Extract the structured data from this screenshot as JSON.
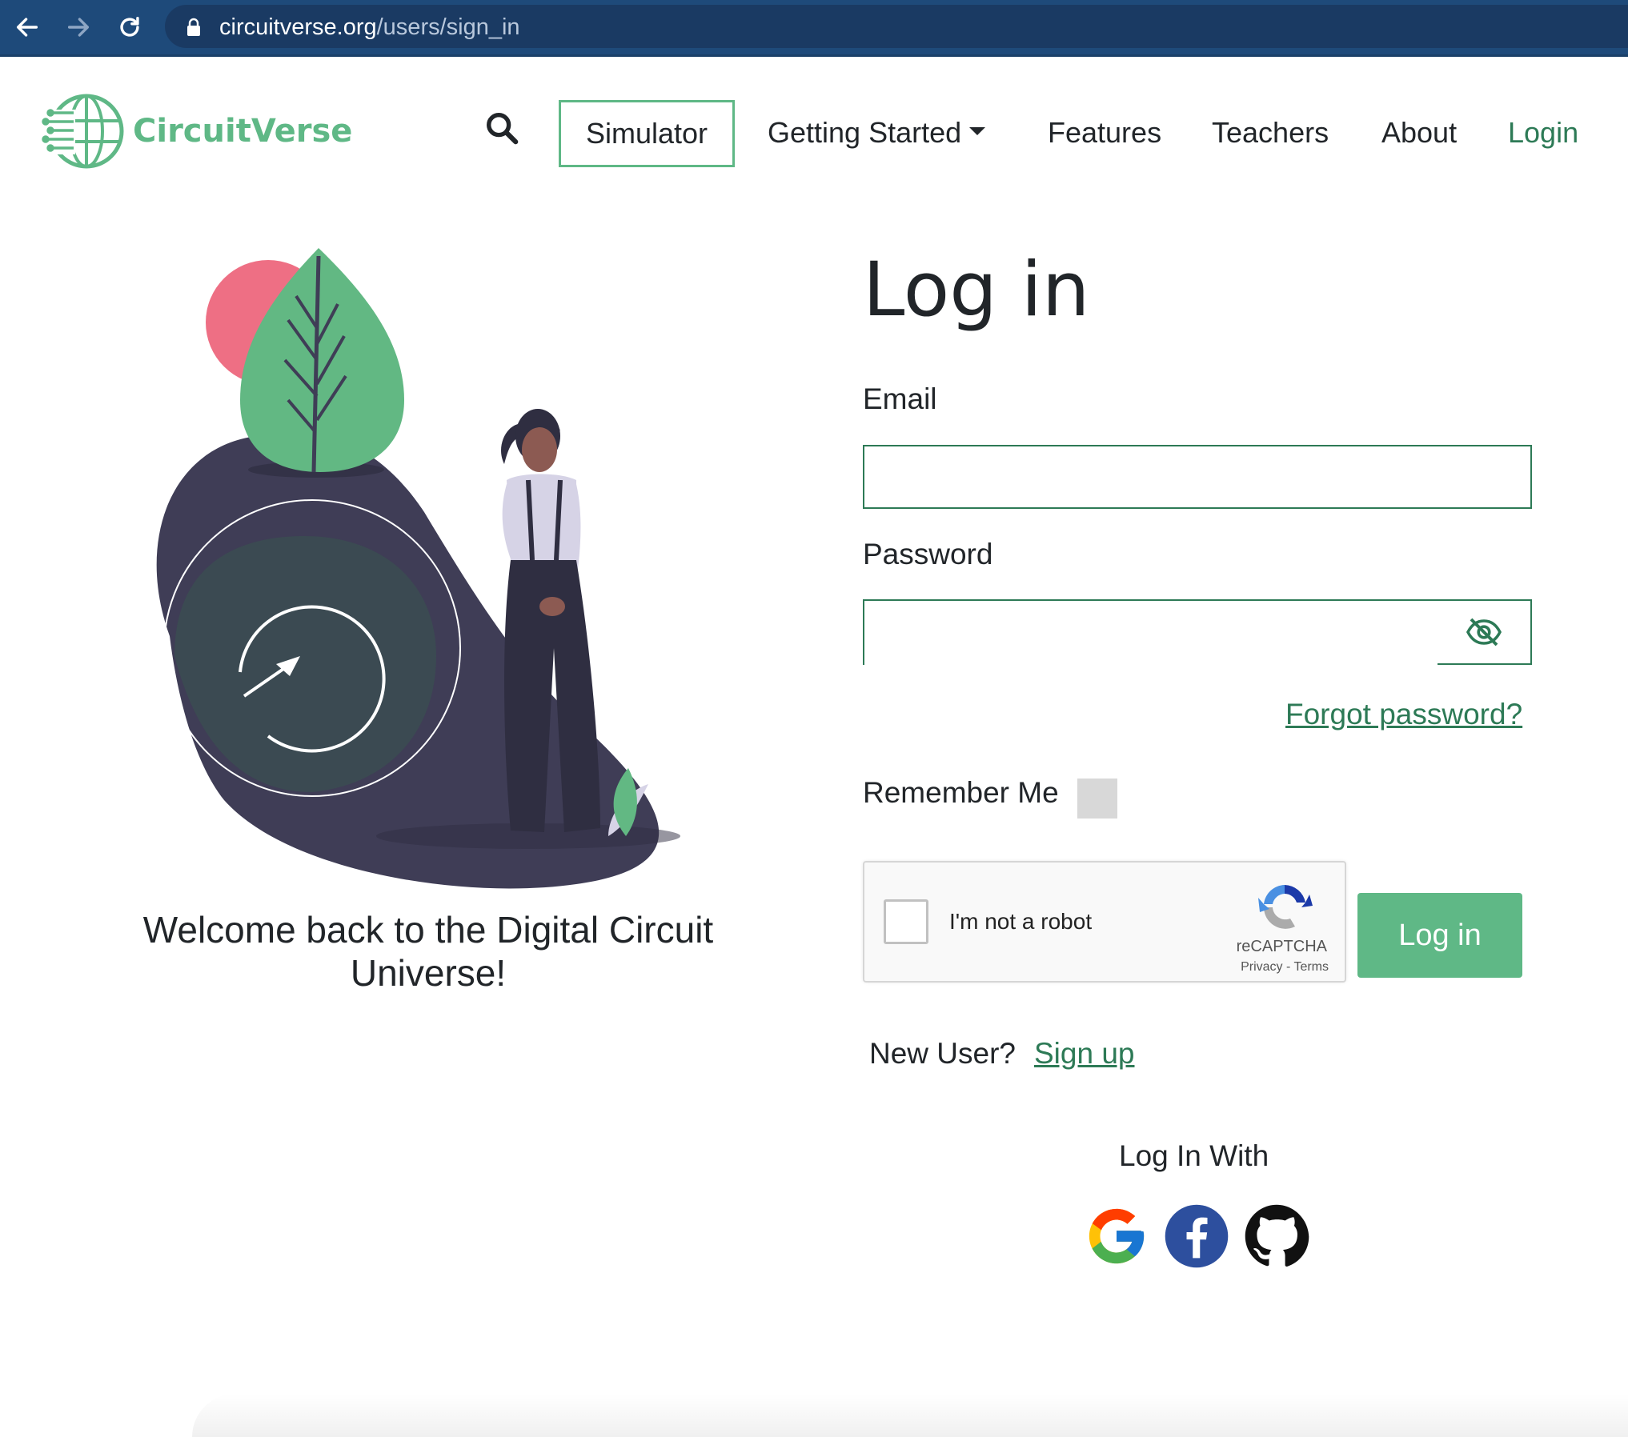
{
  "browser": {
    "url_host": "circuitverse.org",
    "url_path": "/users/sign_in"
  },
  "navbar": {
    "brand": "CircuitVerse",
    "simulator": "Simulator",
    "getting_started": "Getting Started",
    "features": "Features",
    "teachers": "Teachers",
    "about": "About",
    "login": "Login"
  },
  "hero": {
    "welcome": "Welcome back to the Digital Circuit Universe!"
  },
  "form": {
    "title": "Log in",
    "email_label": "Email",
    "email_value": "",
    "password_label": "Password",
    "password_value": "",
    "forgot": "Forgot password?",
    "remember_label": "Remember Me",
    "captcha_label": "I'm not a robot",
    "captcha_brand": "reCAPTCHA",
    "captcha_links": "Privacy - Terms",
    "submit": "Log in",
    "new_user": "New User?",
    "sign_up": "Sign up",
    "login_with": "Log In With"
  },
  "icons": [
    "back-arrow-icon",
    "forward-arrow-icon",
    "reload-icon",
    "lock-icon",
    "search-icon",
    "eye-slash-icon",
    "recaptcha-icon",
    "google-icon",
    "facebook-icon",
    "github-icon"
  ],
  "colors": {
    "brand_green": "#5fb886",
    "dark_green": "#2d7a56",
    "chrome_blue": "#1e4a7a"
  }
}
